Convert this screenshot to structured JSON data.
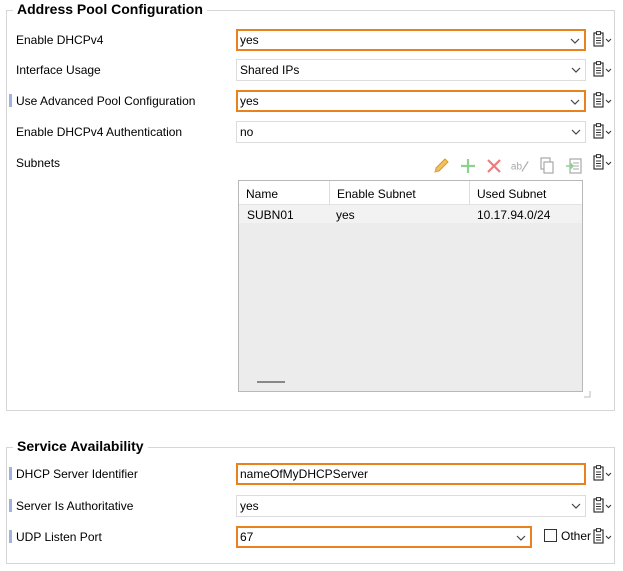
{
  "address_pool": {
    "title": "Address Pool Configuration",
    "rows": {
      "enable_dhcpv4": {
        "label": "Enable DHCPv4",
        "value": "yes"
      },
      "interface_usage": {
        "label": "Interface Usage",
        "value": "Shared IPs"
      },
      "use_advanced_pool": {
        "label": "Use Advanced Pool Configuration",
        "value": "yes"
      },
      "enable_auth": {
        "label": "Enable DHCPv4 Authentication",
        "value": "no"
      }
    },
    "subnets": {
      "label": "Subnets",
      "toolbar_icons": [
        "edit-pencil-icon",
        "add-plus-icon",
        "delete-x-icon",
        "rename-ab-icon",
        "copy-icon",
        "import-icon"
      ],
      "columns": [
        "Name",
        "Enable Subnet",
        "Used Subnet"
      ],
      "rows": [
        {
          "name": "SUBN01",
          "enable": "yes",
          "used": "10.17.94.0/24"
        }
      ]
    }
  },
  "service_availability": {
    "title": "Service Availability",
    "rows": {
      "server_identifier": {
        "label": "DHCP Server Identifier",
        "value": "nameOfMyDHCPServer"
      },
      "authoritative": {
        "label": "Server Is Authoritative",
        "value": "yes"
      },
      "udp_port": {
        "label": "UDP Listen Port",
        "value": "67",
        "other_label": "Other"
      }
    }
  },
  "colors": {
    "highlight": "#e8821e",
    "marker": "#9fb3dd",
    "border": "#d6d6d6"
  }
}
